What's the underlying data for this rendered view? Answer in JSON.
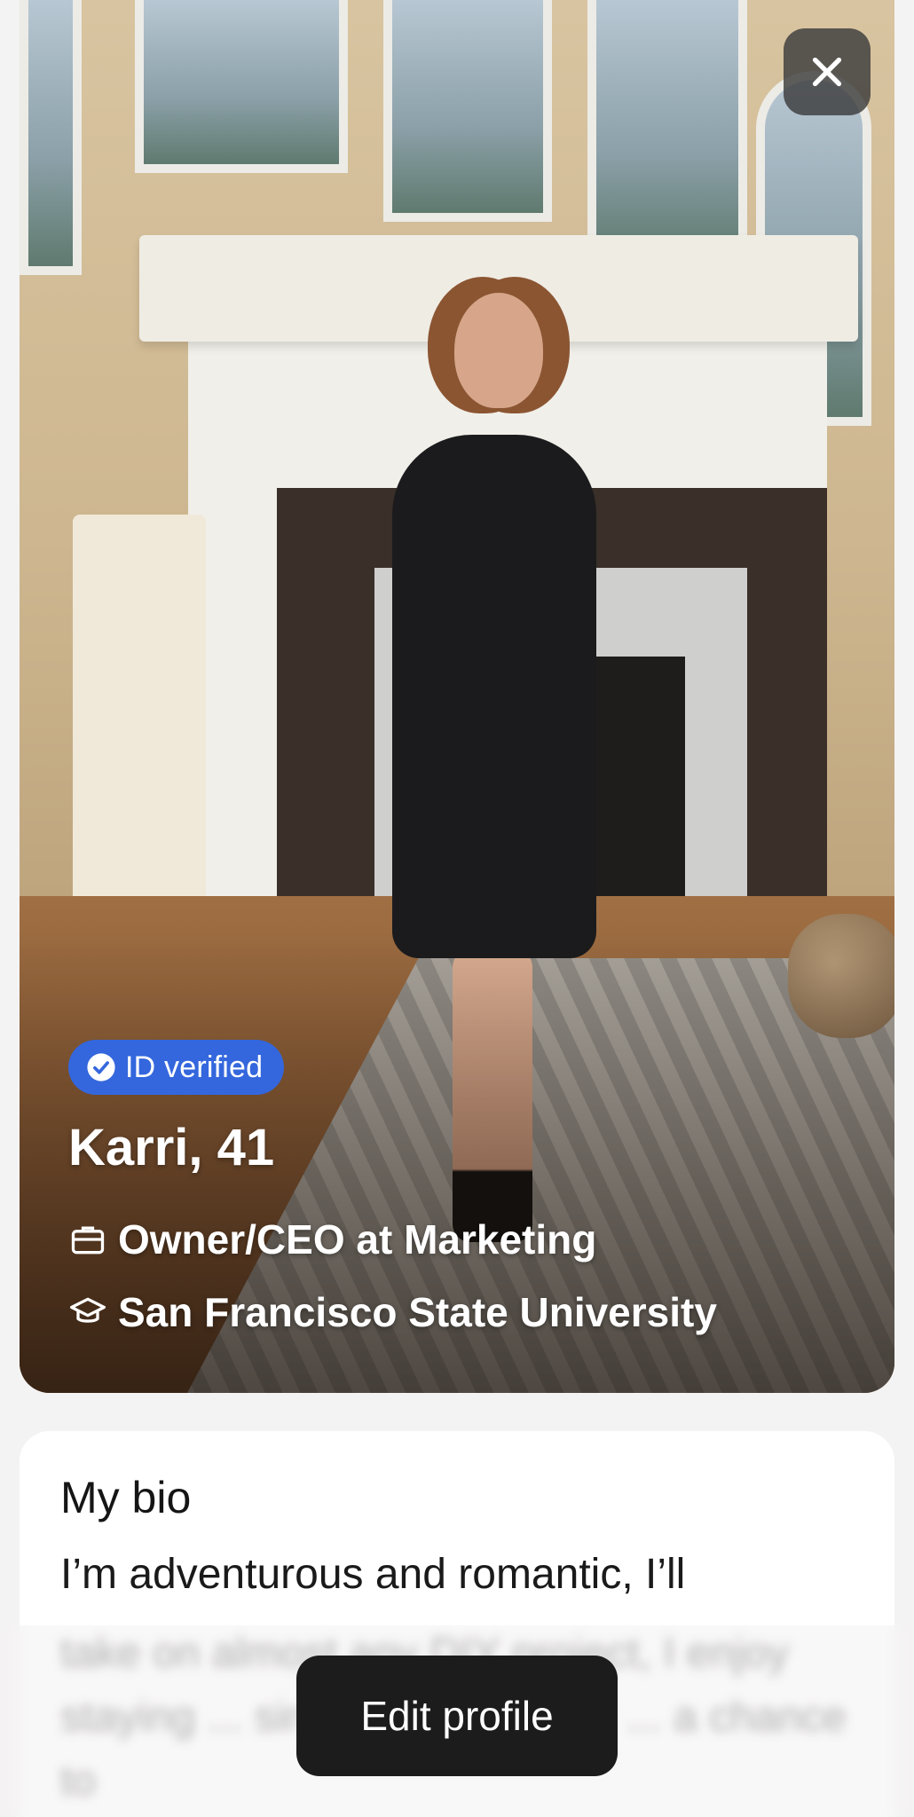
{
  "photo": {
    "close_icon": "close-icon"
  },
  "profile": {
    "verified_label": "ID verified",
    "name_age": "Karri, 41",
    "job": "Owner/CEO at Marketing",
    "school": "San Francisco State University"
  },
  "bio": {
    "title": "My bio",
    "visible_text": "I’m adventurous and romantic, I’ll",
    "blurred_text": "take on almost any DIY project, I enjoy staying ... singing and I never ... a chance to"
  },
  "actions": {
    "edit_profile_label": "Edit profile"
  },
  "colors": {
    "verified_badge": "#3467dd",
    "edit_button": "#1c1c1c",
    "background": "#f4f3f3"
  }
}
